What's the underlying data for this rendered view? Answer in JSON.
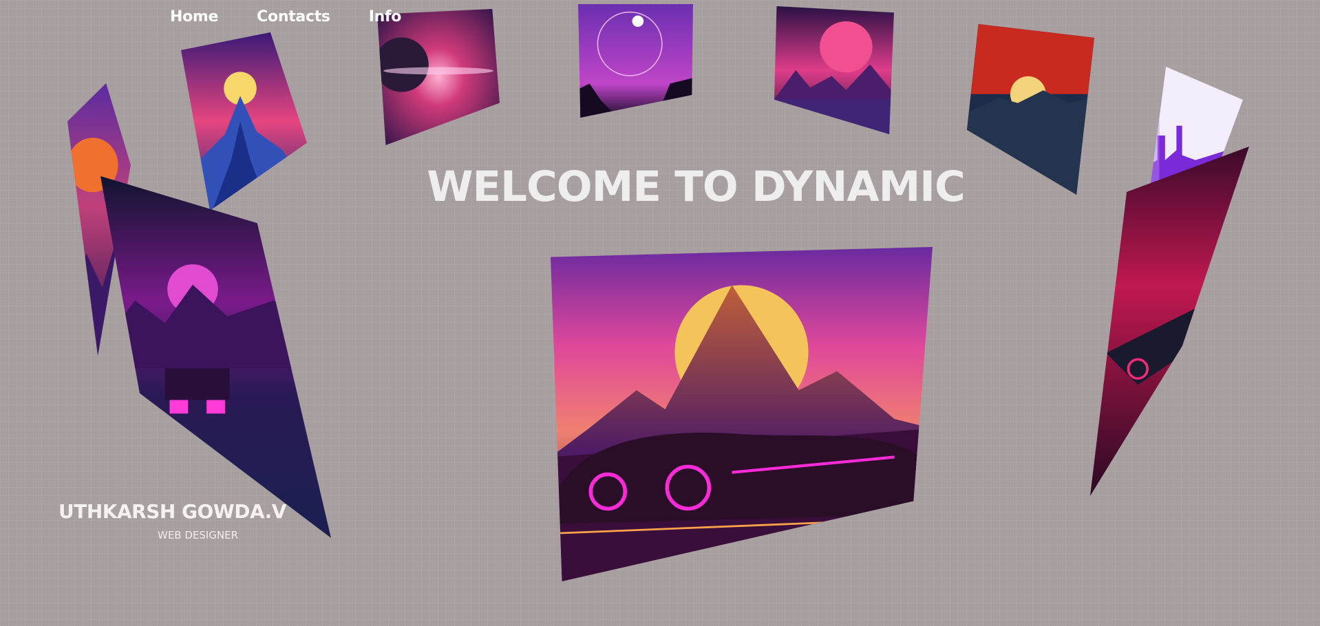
{
  "nav": {
    "items": [
      {
        "label": "Home"
      },
      {
        "label": "Contacts"
      },
      {
        "label": "Info"
      }
    ]
  },
  "hero": {
    "title": "WELCOME TO DYNAMIC"
  },
  "profile": {
    "name": "UTHKARSH GOWDA.V",
    "role": "WEB DESIGNER"
  },
  "gallery": {
    "cards": [
      {
        "name": "sunset-mountain-card"
      },
      {
        "name": "neon-peak-card"
      },
      {
        "name": "planet-nebula-card"
      },
      {
        "name": "ringed-planet-card"
      },
      {
        "name": "mountain-moon-card"
      },
      {
        "name": "red-sky-sun-card"
      },
      {
        "name": "bright-city-card"
      },
      {
        "name": "neon-sports-car-card"
      },
      {
        "name": "retro-car-sunset-card"
      },
      {
        "name": "synthwave-supercar-card"
      }
    ]
  },
  "colors": {
    "background": "#a79e9f",
    "text": "#ffffff",
    "headline": "#eeeeee"
  }
}
